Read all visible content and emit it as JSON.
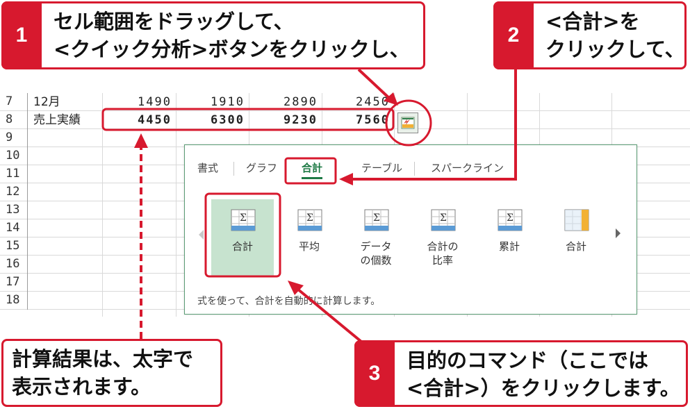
{
  "sheet": {
    "rows": [
      {
        "num": "7",
        "label": "12月",
        "values": [
          "1490",
          "1910",
          "2890",
          "2450"
        ]
      },
      {
        "num": "8",
        "label": "売上実績",
        "values": [
          "4450",
          "6300",
          "9230",
          "7560"
        ]
      },
      {
        "num": "9"
      },
      {
        "num": "10"
      },
      {
        "num": "11"
      },
      {
        "num": "12"
      },
      {
        "num": "13"
      },
      {
        "num": "14"
      },
      {
        "num": "15"
      },
      {
        "num": "16"
      },
      {
        "num": "17"
      },
      {
        "num": "18"
      }
    ]
  },
  "quick_analysis": {
    "button_icon": "quick-analysis-icon",
    "tabs": [
      "書式",
      "グラフ",
      "合計",
      "テーブル",
      "スパークライン"
    ],
    "active_tab": "合計",
    "items": [
      {
        "label": "合計",
        "icon": "sum-row-icon"
      },
      {
        "label": "平均",
        "icon": "average-icon"
      },
      {
        "label": "データ\nの個数",
        "icon": "count-icon"
      },
      {
        "label": "合計の\n比率",
        "icon": "percent-total-icon"
      },
      {
        "label": "累計",
        "icon": "running-total-icon"
      },
      {
        "label": "合計",
        "icon": "sum-column-icon"
      }
    ],
    "description": "式を使って、合計を自動的に計算します。"
  },
  "callouts": {
    "c1": {
      "num": "1",
      "line1": "セル範囲をドラッグして、",
      "line2": "<クイック分析>ボタンをクリックし、"
    },
    "c2": {
      "num": "2",
      "line1": "<合計>を",
      "line2": "クリックして、"
    },
    "c3": {
      "num": "3",
      "line1": "目的のコマンド（ここでは",
      "line2": "<合計>）をクリックします。"
    },
    "note": {
      "line1": "計算結果は、太字で",
      "line2": "表示されます。"
    }
  },
  "colors": {
    "accent_red": "#d7192e",
    "excel_green": "#1e7a45",
    "selection": "#c7e3cf"
  }
}
